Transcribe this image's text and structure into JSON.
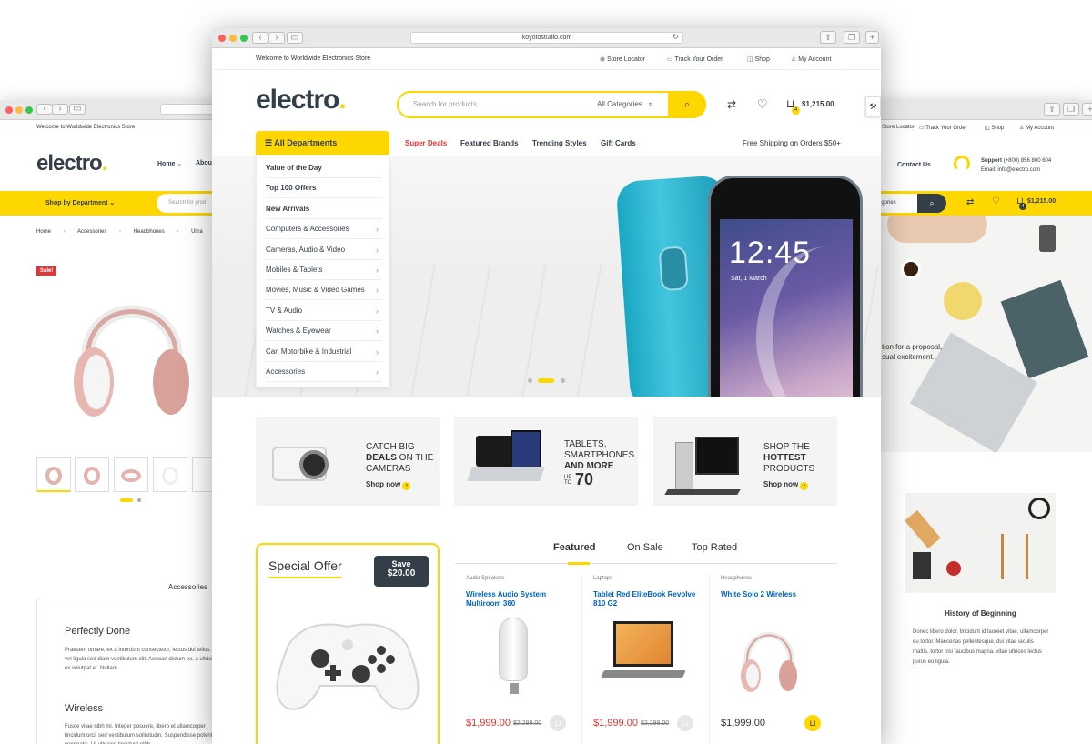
{
  "left_window": {
    "topbar_text": "Welcome to Worldwide Electronics Store",
    "logo_text": "electro",
    "logo_dot": ".",
    "nav": [
      {
        "label": "Home",
        "caret": "⌄"
      },
      {
        "label": "Abou"
      }
    ],
    "shop_by_department": "Shop by Department",
    "search_placeholder": "Search for prod",
    "breadcrumb": [
      "Home",
      "Accessories",
      "Headphones",
      "Ultra"
    ],
    "sale_badge": "Sale!",
    "accessories_label": "Accessories",
    "perfectly_done": {
      "title": "Perfectly Done",
      "text": "Praesent ornare, ex a interdum consectetur, lectus dui tellus. Sed vel ligula sed diam vestibulum elit. Aenean dictum ex, a ultricies ex volutpat et. Nullam"
    },
    "wireless": {
      "title": "Wireless",
      "text": "Fusce vitae nibh mi. Integer posuere, libero et ullamcorper tincidunt orci, sed vestibulum sollicitudin. Suspendisse potenti dui venenatis. Ut ultricies tincidunt nibh."
    }
  },
  "right_window": {
    "topbar": [
      "Store Locator",
      "Track Your Order",
      "Shop",
      "My Account"
    ],
    "contact": "Contact Us",
    "support_label": "Support",
    "support_phone": "(+800) 856 800 604",
    "support_email": "Email: info@electro.com",
    "categories_label": "egories",
    "cart_total": "$1,215.00",
    "cart_count": "4",
    "hero_text_1": "tion for a proposal,",
    "hero_text_2": "sual excitement.",
    "history": {
      "title": "History of Beginning",
      "text": "Donec libero dolor, tincidunt id laoreet vitae, ullamcorper eu tortor. Maecenas pellentesque, dui vitae iaculis mattis, tortor nisi faucibus magna, vitae ultrices lectus purus eu ligula."
    }
  },
  "main": {
    "url": "koyotostudio.com",
    "topbar": {
      "welcome": "Welcome to Worldwide Electronics Store",
      "links": [
        "Store Locator",
        "Track Your Order",
        "Shop",
        "My Account"
      ]
    },
    "logo_text": "electro",
    "logo_dot": ".",
    "search": {
      "placeholder": "Search for products",
      "category": "All Categories"
    },
    "cart": {
      "total": "$1,215.00",
      "count": "4"
    },
    "departments_label": "All Departments",
    "nav": [
      "Super Deals",
      "Featured Brands",
      "Trending Styles",
      "Gift Cards"
    ],
    "shipping_text": "Free Shipping on Orders $50+",
    "categories": [
      {
        "label": "Value of the Day",
        "bold": true
      },
      {
        "label": "Top 100 Offers",
        "bold": true
      },
      {
        "label": "New Arrivals",
        "bold": true
      },
      {
        "label": "Computers & Accessories"
      },
      {
        "label": "Cameras, Audio & Video"
      },
      {
        "label": "Mobiles & Tablets"
      },
      {
        "label": "Movies, Music & Video Games"
      },
      {
        "label": "TV & Audio"
      },
      {
        "label": "Watches & Eyewear"
      },
      {
        "label": "Car, Motorbike & Industrial"
      },
      {
        "label": "Accessories"
      }
    ],
    "hero": {
      "time": "12:45",
      "date": "Sat, 1 March"
    },
    "promos": [
      {
        "line1": "CATCH BIG",
        "line2_bold": "DEALS",
        "line2_rest": " ON THE",
        "line3": "CAMERAS",
        "cta": "Shop now"
      },
      {
        "line1": "TABLETS,",
        "line2": "SMARTPHONES",
        "line3_bold": "AND MORE",
        "upto": "UP TO",
        "number": "70",
        "cta": ""
      },
      {
        "line1": "SHOP THE",
        "line2_bold": "HOTTEST",
        "line3": "PRODUCTS",
        "cta": "Shop now"
      }
    ],
    "special_offer": {
      "title": "Special Offer",
      "save_label": "Save",
      "save_amount": "$20.00"
    },
    "tabs": [
      "Featured",
      "On Sale",
      "Top Rated"
    ],
    "products": [
      {
        "category": "Audio Speakers",
        "name": "Wireless Audio System Multiroom 360",
        "price": "$1,999.00",
        "old_price": "$2,299.00"
      },
      {
        "category": "Laptops",
        "name": "Tablet Red EliteBook Revolve 810 G2",
        "price": "$1,999.00",
        "old_price": "$2,299.00"
      },
      {
        "category": "Headphones",
        "name": "White Solo 2 Wireless",
        "price": "$1,999.00",
        "old_price": ""
      }
    ]
  },
  "colors": {
    "accent": "#fed700",
    "dark": "#333e48",
    "red": "#e63030",
    "blue": "#0062bd"
  }
}
